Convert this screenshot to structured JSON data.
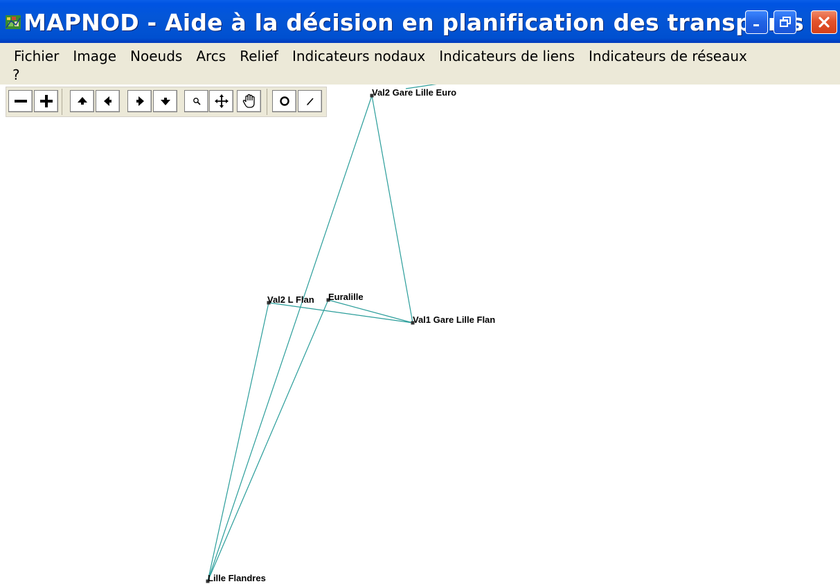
{
  "window": {
    "title": "MAPNOD - Aide à la décision en planification des transports",
    "icon": "mapnod-app-icon",
    "controls": [
      "minimize-icon",
      "restore-icon",
      "close-icon"
    ]
  },
  "menu": {
    "items": [
      "Fichier",
      "Image",
      "Noeuds",
      "Arcs",
      "Relief",
      "Indicateurs nodaux",
      "Indicateurs de liens",
      "Indicateurs de réseaux"
    ],
    "help": "?"
  },
  "toolbar": {
    "buttons": [
      "zoom-out-icon",
      "zoom-in-icon",
      "pan-up-icon",
      "pan-left-icon",
      "pan-right-icon",
      "pan-down-icon",
      "zoom-window-icon",
      "move-icon",
      "hand-icon",
      "node-tool-icon",
      "pencil-icon"
    ]
  },
  "map": {
    "colors": {
      "arc": "#2a9d9a",
      "node": "#333333",
      "label": "#000000"
    },
    "nodes": [
      {
        "id": "n1",
        "label": "Val2 Gare Lille Euro"
      },
      {
        "id": "n2",
        "label": "Val2 L Flan"
      },
      {
        "id": "n3",
        "label": "Euralille"
      },
      {
        "id": "n4",
        "label": "Val1 Gare Lille Flan"
      },
      {
        "id": "n5",
        "label": "Lille Flandres"
      }
    ],
    "arcs": [
      [
        "n1",
        "n4"
      ],
      [
        "n1",
        "n5"
      ],
      [
        "n2",
        "n4"
      ],
      [
        "n3",
        "n4"
      ],
      [
        "n2",
        "n5"
      ]
    ]
  }
}
